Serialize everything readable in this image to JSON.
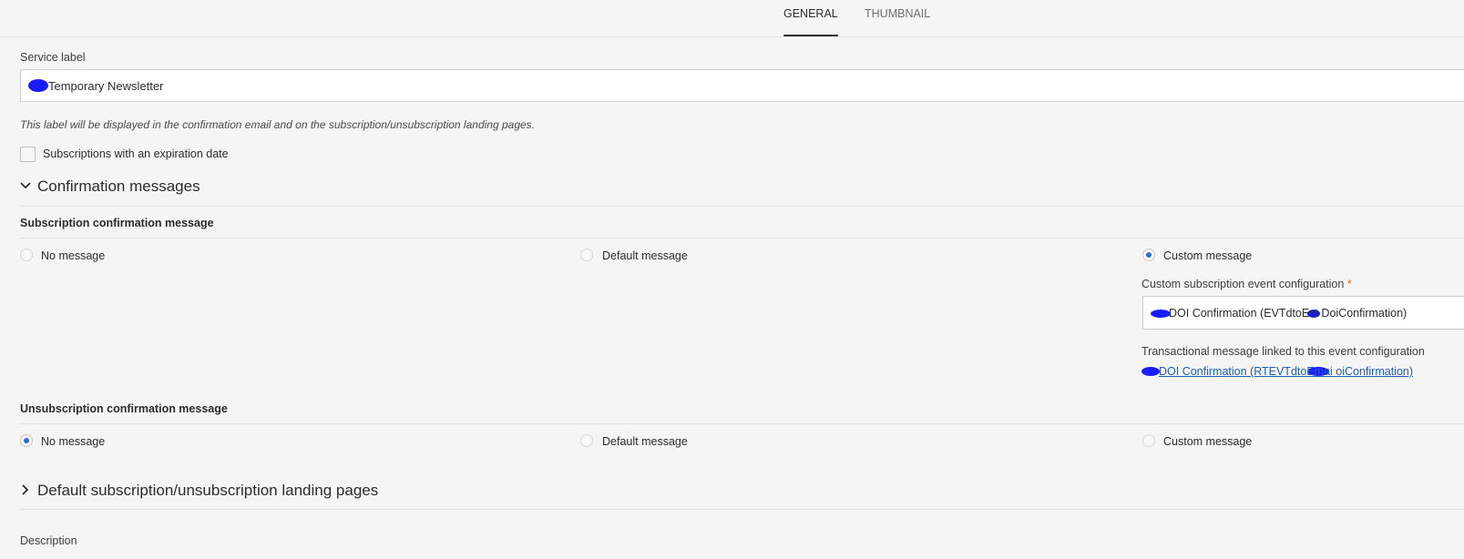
{
  "tabs": [
    {
      "label": "GENERAL",
      "active": true
    },
    {
      "label": "THUMBNAIL",
      "active": false
    }
  ],
  "service_label": {
    "label": "Service label",
    "value": "Temporary Newsletter",
    "hint": "This label will be displayed in the confirmation email and on the subscription/unsubscription landing pages."
  },
  "expiration": {
    "label": "Subscriptions with an expiration date",
    "checked": false
  },
  "confirmation": {
    "title": "Confirmation messages",
    "expanded": true,
    "subscription": {
      "title": "Subscription confirmation message",
      "options": [
        "No message",
        "Default message",
        "Custom message"
      ],
      "selected": "Custom message",
      "event_config_label": "Custom subscription event configuration",
      "required_mark": "*",
      "event_config_value": "DOI Confirmation (EVTdtoEvt DoiConfirmation)",
      "transactional_label": "Transactional message linked to this event configuration",
      "transactional_link": "DOI Confirmation (RTEVTdtoEmai oiConfirmation)"
    },
    "unsubscription": {
      "title": "Unsubscription confirmation message",
      "options": [
        "No message",
        "Default message",
        "Custom message"
      ],
      "selected": "No message"
    }
  },
  "landing_pages": {
    "title": "Default subscription/unsubscription landing pages",
    "expanded": false
  },
  "description": {
    "label": "Description"
  },
  "colors": {
    "accent": "#2f6ec4",
    "link": "#1f5fb5",
    "required": "#e8731c",
    "redaction": "#1a1aff"
  }
}
